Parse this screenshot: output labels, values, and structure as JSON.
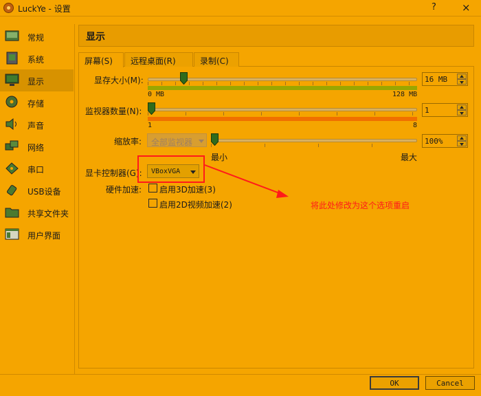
{
  "window": {
    "title": "LuckYe - 设置",
    "help": "?",
    "close": "×"
  },
  "sidebar": {
    "items": [
      {
        "label": "常规",
        "icon": "general-icon"
      },
      {
        "label": "系统",
        "icon": "system-icon"
      },
      {
        "label": "显示",
        "icon": "display-icon",
        "selected": true
      },
      {
        "label": "存储",
        "icon": "storage-icon"
      },
      {
        "label": "声音",
        "icon": "audio-icon"
      },
      {
        "label": "网络",
        "icon": "network-icon"
      },
      {
        "label": "串口",
        "icon": "serial-port-icon"
      },
      {
        "label": "USB设备",
        "icon": "usb-icon"
      },
      {
        "label": "共享文件夹",
        "icon": "shared-folder-icon"
      },
      {
        "label": "用户界面",
        "icon": "user-interface-icon"
      }
    ]
  },
  "section": {
    "title": "显示"
  },
  "tabs": [
    {
      "label": "屏幕(S)",
      "active": true
    },
    {
      "label": "远程桌面(R)",
      "active": false
    },
    {
      "label": "录制(C)",
      "active": false
    }
  ],
  "screen": {
    "video_memory": {
      "label": "显存大小(M):",
      "value_text": "16 MB",
      "value_mb": 16,
      "min_label": "0 MB",
      "max_label": "128 MB"
    },
    "monitor_count": {
      "label": "监视器数量(N):",
      "value_text": "1",
      "value": 1,
      "min_label": "1",
      "max_label": "8"
    },
    "scale_factor": {
      "label": "缩放率:",
      "monitor_select": "全部监视器",
      "value_text": "100%",
      "min_label": "最小",
      "max_label": "最大"
    },
    "graphics_controller": {
      "label": "显卡控制器(G):",
      "value": "VBoxVGA"
    },
    "acceleration": {
      "label": "硬件加速:",
      "enable_3d": "启用3D加速(3)",
      "enable_2d": "启用2D视频加速(2)",
      "enable_3d_checked": false,
      "enable_2d_checked": false
    }
  },
  "annotation": {
    "text": "将此处修改为这个选项重启",
    "color": "#ff1a1a"
  },
  "buttons": {
    "ok": "OK",
    "cancel": "Cancel"
  },
  "colors": {
    "background": "#f5a500",
    "selected_item": "#d79200",
    "slider_good": "#9aa600",
    "slider_bad": "#f07000"
  }
}
